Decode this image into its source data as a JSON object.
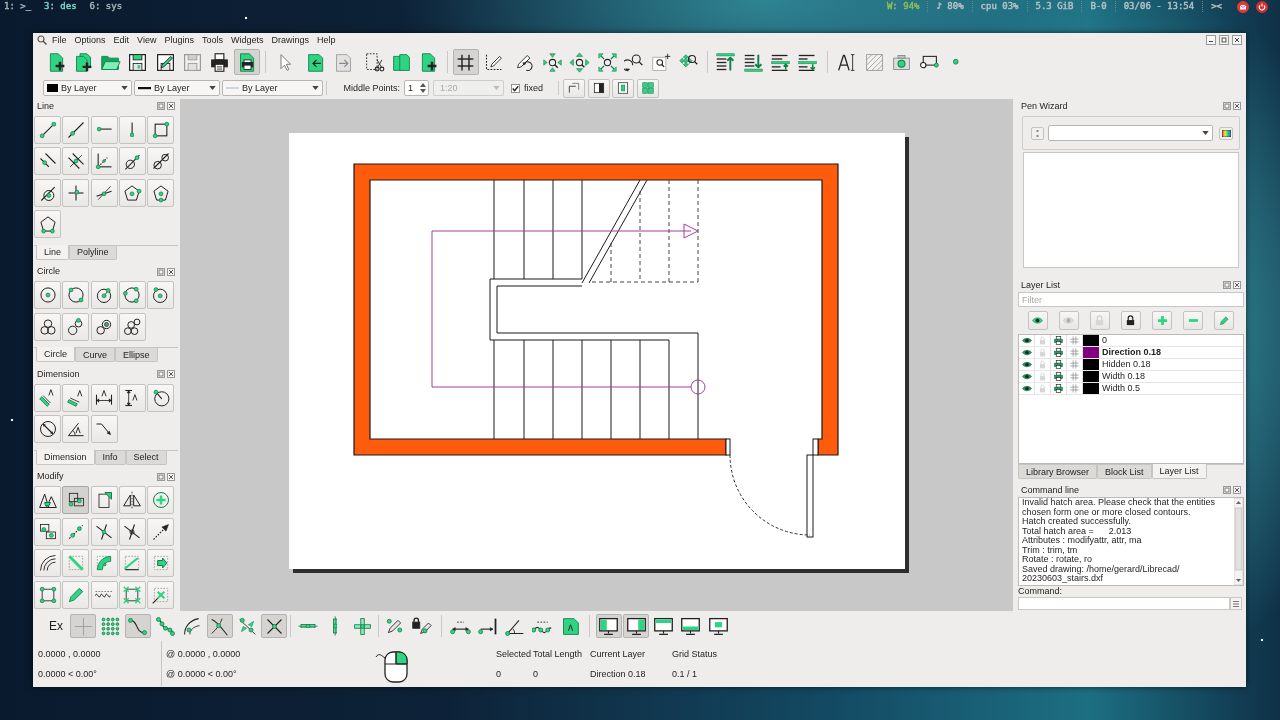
{
  "top_bar": {
    "workspaces": [
      {
        "label": "1: >_",
        "selected": false
      },
      {
        "label": "3: des",
        "selected": true
      },
      {
        "label": "6: sys",
        "selected": false
      }
    ],
    "indicators": [
      {
        "text": "W: 94%",
        "color": "#8cc152"
      },
      {
        "text": "♪ 80%",
        "color": "#b4c0c4"
      },
      {
        "text": "cpu 03%",
        "color": "#b4c0c4"
      },
      {
        "text": "5.3 GiB",
        "color": "#b4c0c4"
      },
      {
        "text": "B-0",
        "color": "#b4c0c4"
      },
      {
        "text": "03/06 - 13:54",
        "color": "#b4c0c4"
      },
      {
        "text": "><",
        "color": "#b4c0c4"
      }
    ]
  },
  "window": {
    "menu": [
      "File",
      "Options",
      "Edit",
      "View",
      "Plugins",
      "Tools",
      "Widgets",
      "Drawings",
      "Help"
    ]
  },
  "main_toolbar": [
    {
      "on": false
    },
    {
      "on": false
    },
    {
      "on": false
    },
    {
      "on": false
    },
    {
      "on": false
    },
    {
      "on": false
    },
    {
      "on": false
    },
    {
      "on": true
    },
    {
      "on": false
    },
    {
      "on": false
    },
    {
      "on": false
    },
    {
      "on": false
    },
    {
      "on": false
    },
    {
      "on": false
    },
    {
      "on": true
    },
    {
      "on": false
    },
    {
      "on": false
    },
    {
      "on": false
    },
    {
      "on": false
    },
    {
      "on": false
    },
    {
      "on": false
    },
    {
      "on": false
    },
    {
      "on": false
    },
    {
      "on": false
    },
    {
      "on": false
    },
    {
      "on": false
    },
    {
      "on": false
    },
    {
      "on": false
    },
    {
      "on": false
    },
    {
      "on": false
    },
    {
      "on": false
    },
    {
      "on": false
    }
  ],
  "pen_toolbar": {
    "pen_color": "By Layer",
    "pen_width": "By Layer",
    "pen_type": "By Layer",
    "middle_points_label": "Middle Points:",
    "middle_points": "1",
    "scale": {
      "value": "1:20",
      "disabled": true
    },
    "fixed": {
      "label": "fixed",
      "checked": true
    },
    "buttons": [
      {
        "on": false
      },
      {
        "on": false
      },
      {
        "on": false
      },
      {
        "on": false
      }
    ]
  },
  "left_dock": [
    {
      "title": "Line",
      "tools": [
        {
          "on": false
        },
        {
          "on": false
        },
        {
          "on": false
        },
        {
          "on": false
        },
        {
          "on": false
        },
        {
          "on": false
        },
        {
          "on": false
        },
        {
          "on": false
        },
        {
          "on": false
        },
        {
          "on": false
        },
        {
          "on": false
        },
        {
          "on": false
        },
        {
          "on": false
        },
        {
          "on": false
        },
        {
          "on": false
        },
        {
          "on": false
        }
      ],
      "tabs": [
        {
          "label": "Line",
          "selected": true
        },
        {
          "label": "Polyline",
          "selected": false
        }
      ]
    },
    {
      "title": "Circle",
      "tools": [
        {
          "on": false
        },
        {
          "on": false
        },
        {
          "on": false
        },
        {
          "on": false
        },
        {
          "on": false
        },
        {
          "on": false
        },
        {
          "on": false
        },
        {
          "on": false
        },
        {
          "on": false
        }
      ],
      "tabs": [
        {
          "label": "Circle",
          "selected": true
        },
        {
          "label": "Curve",
          "selected": false
        },
        {
          "label": "Ellipse",
          "selected": false
        }
      ]
    },
    {
      "title": "Dimension",
      "tools": [
        {
          "on": false
        },
        {
          "on": false
        },
        {
          "on": false
        },
        {
          "on": false
        },
        {
          "on": false
        },
        {
          "on": false
        },
        {
          "on": false
        },
        {
          "on": false
        }
      ],
      "tabs": [
        {
          "label": "Dimension",
          "selected": true
        },
        {
          "label": "Info",
          "selected": false
        },
        {
          "label": "Select",
          "selected": false
        }
      ]
    },
    {
      "title": "Modify",
      "tools": [
        {
          "on": false
        },
        {
          "on": true
        },
        {
          "on": false
        },
        {
          "on": false
        },
        {
          "on": false
        },
        {
          "on": false
        },
        {
          "on": false
        },
        {
          "on": false
        },
        {
          "on": false
        },
        {
          "on": false
        },
        {
          "on": false
        },
        {
          "on": false
        },
        {
          "on": false
        },
        {
          "on": false
        },
        {
          "on": false
        },
        {
          "on": false
        },
        {
          "on": false
        },
        {
          "on": false
        },
        {
          "on": false
        },
        {
          "on": false
        }
      ]
    }
  ],
  "right_dock": {
    "pen_wizard": {
      "title": "Pen Wizard"
    },
    "layer_list": {
      "title": "Layer List",
      "filter": {
        "placeholder": "Filter"
      },
      "layers": [
        {
          "name": "0",
          "visible": true,
          "locked": false,
          "printable": true,
          "color": "#000000",
          "active": false
        },
        {
          "name": "Direction 0.18",
          "visible": true,
          "locked": false,
          "printable": true,
          "color": "#800080",
          "active": true
        },
        {
          "name": "Hidden 0.18",
          "visible": true,
          "locked": false,
          "printable": true,
          "color": "#000000",
          "active": false
        },
        {
          "name": "Width 0.18",
          "visible": true,
          "locked": false,
          "printable": true,
          "color": "#000000",
          "active": false
        },
        {
          "name": "Width 0.5",
          "visible": true,
          "locked": false,
          "printable": true,
          "color": "#000000",
          "active": false
        }
      ]
    },
    "tabs": [
      {
        "label": "Library Browser",
        "selected": false
      },
      {
        "label": "Block List",
        "selected": false
      },
      {
        "label": "Layer List",
        "selected": true
      }
    ],
    "command_line": {
      "title": "Command line",
      "lines": [
        "Invalid hatch area. Please check that the entities",
        "chosen form one or more closed contours.",
        "Hatch created successfully.",
        "Total hatch area =      2.013",
        "Attributes : modifyattr, attr, ma",
        "Trim : trim, tm",
        "Rotate : rotate, ro",
        "Saved drawing: /home/gerard/Librecad/",
        "20230603_stairs.dxf"
      ],
      "prompt": "Command:"
    }
  },
  "snap_toolbar": {
    "exclusive": {
      "label": "Ex",
      "on": false
    },
    "snaps": [
      {
        "on": true
      },
      {
        "on": false
      },
      {
        "on": true
      },
      {
        "on": false
      },
      {
        "on": false
      },
      {
        "on": true
      },
      {
        "on": false
      },
      {
        "on": true
      }
    ],
    "restrictions": [
      {
        "on": false
      },
      {
        "on": false
      },
      {
        "on": false
      }
    ],
    "relative_zero": [
      {
        "on": false
      },
      {
        "on": false
      }
    ],
    "info": [
      {
        "on": false
      },
      {
        "on": false
      },
      {
        "on": false
      },
      {
        "on": false
      },
      {
        "on": false
      }
    ],
    "views": [
      {
        "on": true
      },
      {
        "on": true
      },
      {
        "on": false
      },
      {
        "on": false
      },
      {
        "on": false
      }
    ]
  },
  "status_bar": {
    "absolute": {
      "cartesian": "0.0000 , 0.0000",
      "polar": "0.0000 < 0.00°"
    },
    "relative": {
      "cartesian": "@ 0.0000 , 0.0000",
      "polar": "@ 0.0000 < 0.00°"
    },
    "fields": [
      {
        "label": "Selected",
        "value": "0"
      },
      {
        "label": "Total Length",
        "value": "0"
      },
      {
        "label": "Current Layer",
        "value": "Direction 0.18"
      },
      {
        "label": "Grid Status",
        "value": "0.1 / 1"
      }
    ]
  }
}
